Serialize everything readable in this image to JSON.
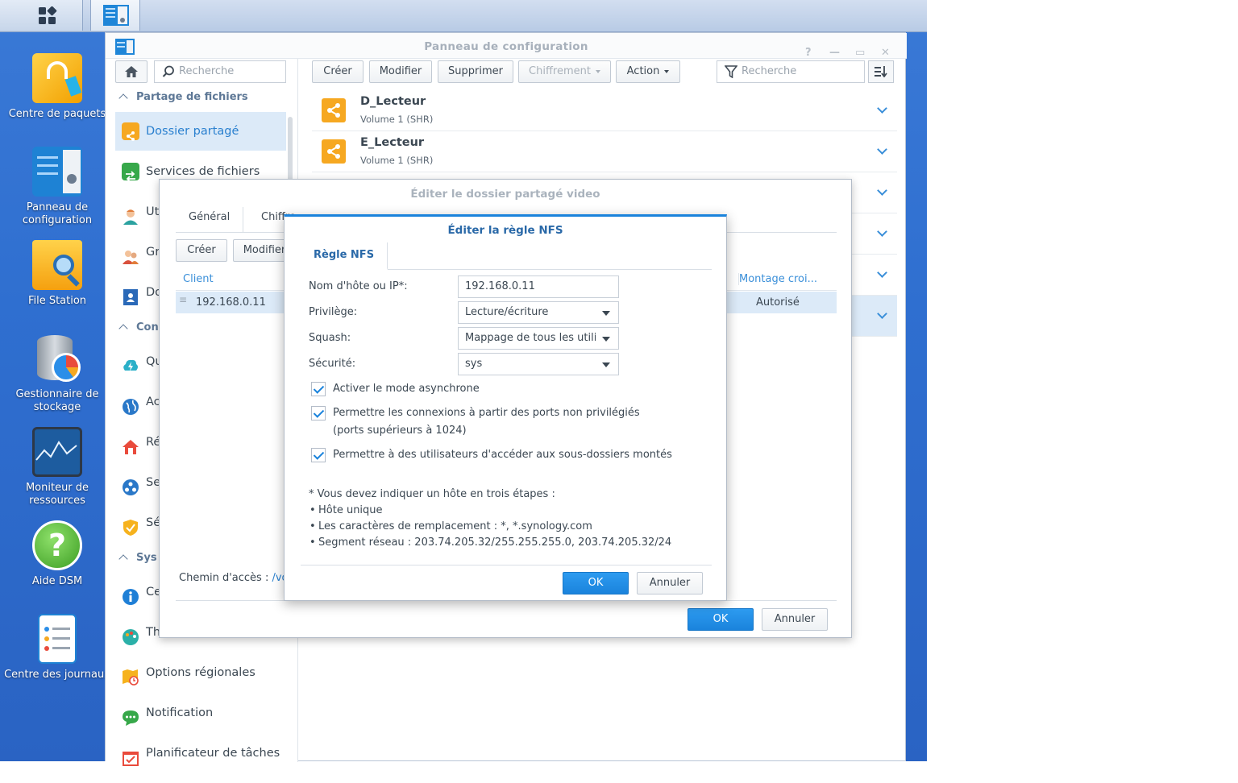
{
  "desktop": {
    "icons": [
      {
        "label": "Centre de paquets"
      },
      {
        "label": "Panneau de configuration"
      },
      {
        "label": "File Station"
      },
      {
        "label": "Gestionnaire de stockage"
      },
      {
        "label": "Moniteur de ressources"
      },
      {
        "label": "Aide DSM"
      },
      {
        "label": "Centre des journaux"
      }
    ]
  },
  "control_panel": {
    "title": "Panneau de configuration",
    "window_controls": [
      "?",
      "—",
      "▭",
      "✕"
    ],
    "sidebar": {
      "search_placeholder": "Recherche",
      "section_file_sharing": "Partage de fichiers",
      "section_connectivity": "Con",
      "section_system": "Sys",
      "items": [
        {
          "label": "Dossier partagé",
          "icon": "shared-folder-icon"
        },
        {
          "label": "Services de fichiers",
          "icon": "file-services-icon"
        },
        {
          "label": "Ut",
          "icon": "user-icon"
        },
        {
          "label": "Gr",
          "icon": "group-icon"
        },
        {
          "label": "Do",
          "icon": "domain-icon"
        },
        {
          "label": "Qu",
          "icon": "quickconnect-icon"
        },
        {
          "label": "Ac",
          "icon": "external-access-icon"
        },
        {
          "label": "Ré",
          "icon": "network-icon"
        },
        {
          "label": "Se",
          "icon": "dhcp-icon"
        },
        {
          "label": "Sé",
          "icon": "security-icon"
        },
        {
          "label": "Ce",
          "icon": "info-icon"
        },
        {
          "label": "Th",
          "icon": "theme-icon"
        },
        {
          "label": "Options régionales",
          "icon": "regional-options-icon"
        },
        {
          "label": "Notification",
          "icon": "notification-icon"
        },
        {
          "label": "Planificateur de tâches",
          "icon": "task-scheduler-icon"
        }
      ]
    },
    "toolbar": {
      "create": "Créer",
      "edit": "Modifier",
      "delete": "Supprimer",
      "encryption": "Chiffrement",
      "action": "Action",
      "search_placeholder": "Recherche"
    },
    "shares": [
      {
        "name": "D_Lecteur",
        "volume": "Volume 1 (SHR)"
      },
      {
        "name": "E_Lecteur",
        "volume": "Volume 1 (SHR)"
      }
    ]
  },
  "edit_share": {
    "title": "Éditer le dossier partagé video",
    "tabs": [
      "Général",
      "Chiffre"
    ],
    "create": "Créer",
    "edit": "Modifier",
    "columns": {
      "client": "Client",
      "cross_mount": "Montage croi..."
    },
    "rows": [
      {
        "client": "192.168.0.11",
        "cross_mount": "Autorisé"
      }
    ],
    "path_label": "Chemin d'accès :",
    "path_value": "/vo",
    "ok": "OK",
    "cancel": "Annuler"
  },
  "nfs_rule": {
    "title": "Éditer la règle NFS",
    "tab": "Règle NFS",
    "host_label": "Nom d'hôte ou IP*:",
    "host_value": "192.168.0.11",
    "privilege_label": "Privilège:",
    "privilege_value": "Lecture/écriture",
    "squash_label": "Squash:",
    "squash_value": "Mappage de tous les utilis",
    "security_label": "Sécurité:",
    "security_value": "sys",
    "async_label": "Activer le mode asynchrone",
    "async_checked": true,
    "nonpriv_label": "Permettre les connexions à partir des ports non privilégiés (ports supérieurs à 1024)",
    "nonpriv_checked": true,
    "subfolder_label": "Permettre à des utilisateurs d'accéder aux sous-dossiers montés",
    "subfolder_checked": true,
    "note_title": "* Vous devez indiquer un hôte en trois étapes :",
    "note_items": [
      "Hôte unique",
      "Les caractères de remplacement : *, *.synology.com",
      "Segment réseau : 203.74.205.32/255.255.255.0, 203.74.205.32/24"
    ],
    "ok": "OK",
    "cancel": "Annuler"
  }
}
